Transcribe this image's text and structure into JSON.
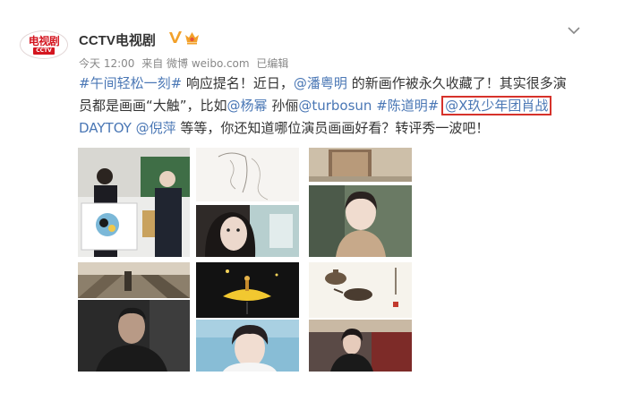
{
  "account": {
    "logo_main": "电视剧",
    "logo_sub": "CCTV",
    "name": "CCTV电视剧"
  },
  "meta": {
    "time": "今天 12:00",
    "source": "来自 微博 weibo.com",
    "edited": "已编辑"
  },
  "post": {
    "line1": [
      {
        "text": "#午间轻松一刻#",
        "link": true
      },
      {
        "text": " 响应提名！近日，",
        "link": false
      },
      {
        "text": "@潘粤明",
        "link": true
      },
      {
        "text": " 的新画作被永久收藏了！其实很多演",
        "link": false
      }
    ],
    "line2": [
      {
        "text": "员都是画画“大触”，比如",
        "link": false
      },
      {
        "text": "@杨幂",
        "link": true
      },
      {
        "text": " 孙俪",
        "link": false
      },
      {
        "text": "@turbosun",
        "link": true
      },
      {
        "text": " ",
        "link": false
      },
      {
        "text": "#陈道明#",
        "link": true
      },
      {
        "text": " ",
        "link": false
      },
      {
        "text": "@X玖少年团肖战",
        "link": true,
        "boxed": true
      }
    ],
    "line3": [
      {
        "text": "DAYTOY",
        "link": true
      },
      {
        "text": " ",
        "link": false
      },
      {
        "text": "@倪萍",
        "link": true
      },
      {
        "text": " 等等，你还知道哪位演员画画好看？转评秀一波吧！",
        "link": false
      }
    ]
  },
  "photos": [
    {
      "name": "photo-award-ceremony"
    },
    {
      "name": "photo-sketch-drawing"
    },
    {
      "name": "photo-actress-portrait"
    },
    {
      "name": "photo-framed-painting"
    },
    {
      "name": "photo-short-hair-actress"
    },
    {
      "name": "photo-street-painting"
    },
    {
      "name": "photo-actor-dark-portrait"
    },
    {
      "name": "photo-night-illustration"
    },
    {
      "name": "photo-young-actor"
    },
    {
      "name": "photo-teapot-ink-painting"
    },
    {
      "name": "photo-actress-gala"
    }
  ],
  "colors": {
    "link": "#4a77b5",
    "highlight_box": "#d6322b",
    "brand_red": "#d4151f",
    "verify_gold": "#f2a12b"
  },
  "icons": [
    "verified-v-icon",
    "vip-icon",
    "chevron-down-icon"
  ]
}
